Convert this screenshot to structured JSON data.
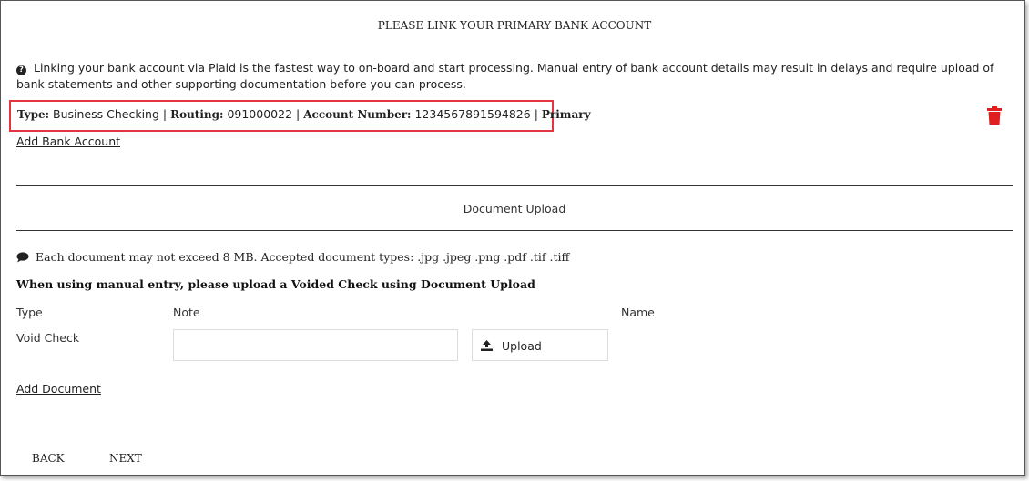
{
  "page": {
    "title": "PLEASE LINK YOUR PRIMARY BANK ACCOUNT"
  },
  "notice": {
    "text": "Linking your bank account via Plaid is the fastest way to on-board and start processing. Manual entry of bank account details may result in delays and require upload of bank statements and other supporting documentation before you can process."
  },
  "account": {
    "type_label": "Type:",
    "type_value": "Business Checking",
    "routing_label": "Routing:",
    "routing_value": "091000022",
    "account_label": "Account Number:",
    "account_value": "1234567891594826",
    "status": "Primary",
    "separator": "|"
  },
  "add_bank_account": "Add Bank Account",
  "document_upload": {
    "title": "Document Upload",
    "info": "Each document may not exceed 8 MB. Accepted document types: .jpg .jpeg .png .pdf .tif .tiff",
    "instruction": "When using manual entry, please upload a Voided Check using Document Upload",
    "columns": {
      "type": "Type",
      "note": "Note",
      "name": "Name"
    },
    "row": {
      "type": "Void Check",
      "note_value": "",
      "upload_label": "Upload"
    },
    "add_document": "Add Document"
  },
  "nav": {
    "back": "BACK",
    "next": "NEXT"
  },
  "colors": {
    "highlight": "#e3343f",
    "trash": "#e02020"
  },
  "icons": {
    "notice": "question-circle-icon",
    "trash": "trash-icon",
    "info": "comment-icon",
    "upload": "upload-icon"
  }
}
